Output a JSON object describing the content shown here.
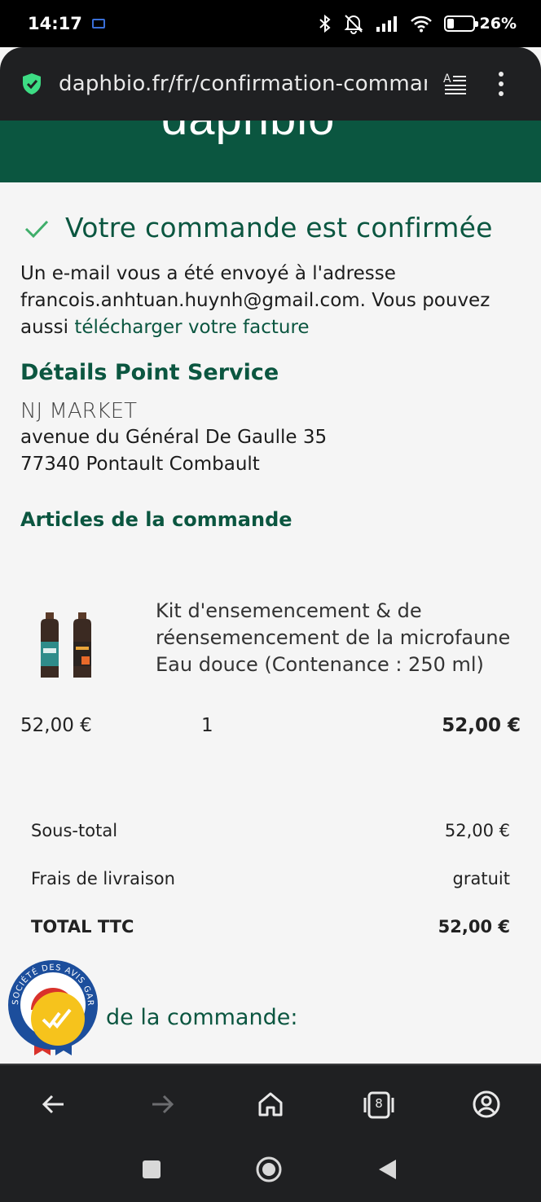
{
  "status_bar": {
    "time": "14:17",
    "battery": "26%"
  },
  "browser": {
    "url": "daphbio.fr/fr/confirmation-commande"
  },
  "site": {
    "logo_text": "daphbio",
    "brand_color": "#0b5640"
  },
  "confirmation": {
    "title": "Votre commande est confirmée",
    "email_line1": "Un e-mail vous a été envoyé à l'adresse",
    "email_line2": "francois.anhtuan.huynh@gmail.com. Vous pouvez",
    "email_line3_prefix": "aussi ",
    "invoice_link": "télécharger votre facture"
  },
  "point_service": {
    "heading": "Détails Point Service",
    "name": "NJ MARKET",
    "street": "avenue du Général De Gaulle 35",
    "city": "77340 Pontault Combault"
  },
  "order": {
    "heading": "Articles de la commande",
    "items": [
      {
        "name_line1": "Kit d'ensemencement & de",
        "name_line2": "réensemencement de la microfaune",
        "name_line3": "Eau douce (Contenance : 250 ml)",
        "unit_price": "52,00 €",
        "quantity": "1",
        "total": "52,00 €"
      }
    ]
  },
  "totals": {
    "subtotal_label": "Sous-total",
    "subtotal_value": "52,00 €",
    "shipping_label": "Frais de livraison",
    "shipping_value": "gratuit",
    "total_label": "TOTAL TTC",
    "total_value": "52,00 €"
  },
  "next_section": {
    "heading_visible": "de la commande:"
  },
  "badge": {
    "text": "SOCIÉTÉ DES AVIS GARANTIS"
  },
  "icons": {
    "nav": [
      "back-arrow-icon",
      "forward-arrow-icon",
      "home-icon",
      "tabs-icon",
      "account-icon"
    ],
    "system": [
      "recents-icon",
      "home-circle-icon",
      "back-triangle-icon"
    ]
  },
  "tabs_count": "8"
}
